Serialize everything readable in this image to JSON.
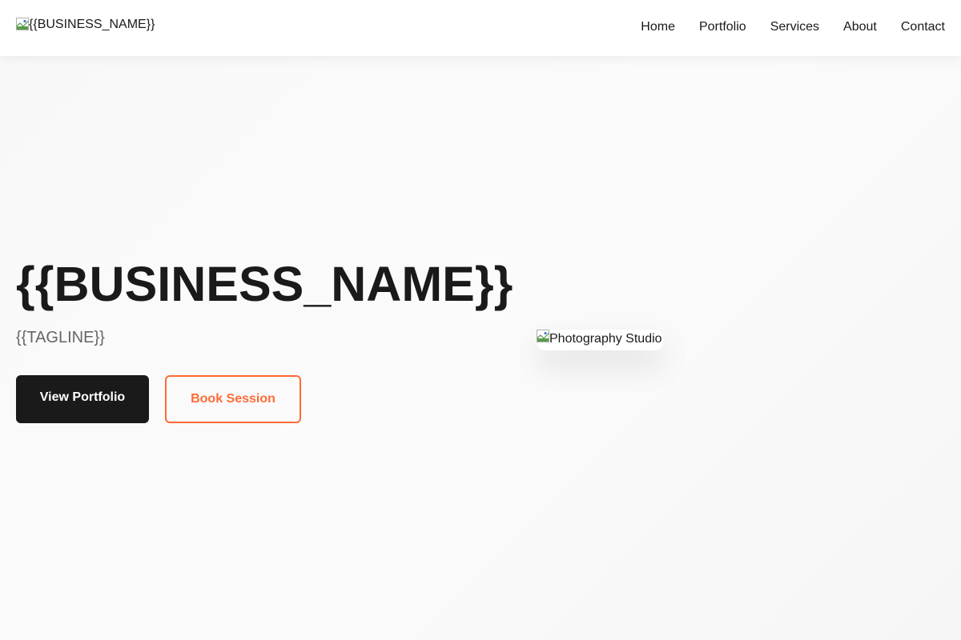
{
  "header": {
    "logo_alt": "{{BUSINESS_NAME}}",
    "nav": [
      "Home",
      "Portfolio",
      "Services",
      "About",
      "Contact"
    ]
  },
  "hero": {
    "title": "{{BUSINESS_NAME}}",
    "tagline": "{{TAGLINE}}",
    "primary_button": "View Portfolio",
    "secondary_button": "Book Session",
    "image_alt": "Photography Studio"
  },
  "colors": {
    "accent": "#ff6b35",
    "dark": "#1a1a1a",
    "muted": "#666666"
  },
  "icons": {
    "broken_image": "broken-image-icon"
  }
}
